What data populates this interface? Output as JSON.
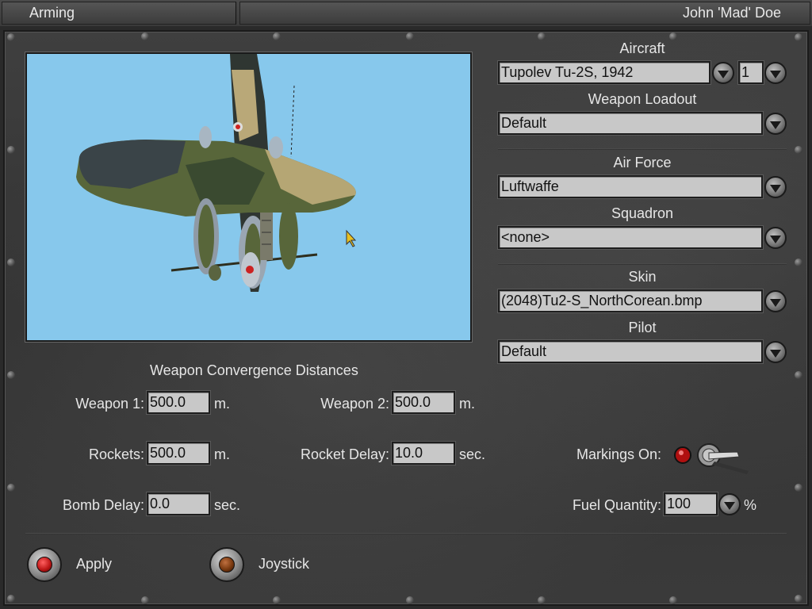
{
  "titlebar": {
    "left": "Arming",
    "right": "John 'Mad' Doe"
  },
  "aircraft": {
    "label": "Aircraft",
    "value": "Tupolev Tu-2S, 1942",
    "number": "1"
  },
  "loadout": {
    "label": "Weapon Loadout",
    "value": "Default"
  },
  "air_force": {
    "label": "Air Force",
    "value": "Luftwaffe"
  },
  "squadron": {
    "label": "Squadron",
    "value": "<none>"
  },
  "skin": {
    "label": "Skin",
    "value": "(2048)Tu2-S_NorthCorean.bmp"
  },
  "pilot": {
    "label": "Pilot",
    "value": "Default"
  },
  "convergence": {
    "heading": "Weapon Convergence Distances",
    "weapon1": {
      "label": "Weapon 1:",
      "value": "500.0",
      "unit": "m."
    },
    "weapon2": {
      "label": "Weapon 2:",
      "value": "500.0",
      "unit": "m."
    },
    "rockets": {
      "label": "Rockets:",
      "value": "500.0",
      "unit": "m."
    },
    "rocket_delay": {
      "label": "Rocket Delay:",
      "value": "10.0",
      "unit": "sec."
    },
    "bomb_delay": {
      "label": "Bomb Delay:",
      "value": "0.0",
      "unit": "sec."
    }
  },
  "markings": {
    "label": "Markings On:"
  },
  "fuel": {
    "label": "Fuel Quantity:",
    "value": "100",
    "unit": "%"
  },
  "buttons": {
    "apply": "Apply",
    "joystick": "Joystick"
  },
  "colors": {
    "preview_sky": "#87c8ec",
    "apply_lamp": "#c01818",
    "joystick_lamp": "#7a3a10",
    "markings_lamp": "#b01010"
  },
  "icons": [
    "dropdown-arrow-icon",
    "toggle-switch-icon",
    "mouse-cursor-icon",
    "rivet-icon"
  ]
}
